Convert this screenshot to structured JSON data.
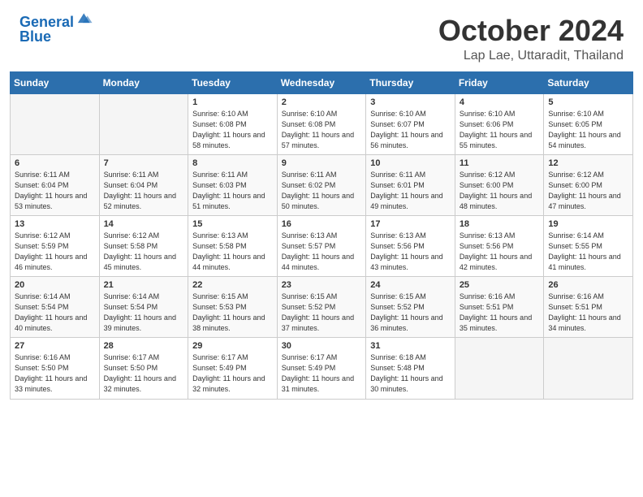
{
  "header": {
    "logo_line1": "General",
    "logo_line2": "Blue",
    "month": "October 2024",
    "location": "Lap Lae, Uttaradit, Thailand"
  },
  "weekdays": [
    "Sunday",
    "Monday",
    "Tuesday",
    "Wednesday",
    "Thursday",
    "Friday",
    "Saturday"
  ],
  "weeks": [
    [
      {
        "day": "",
        "info": ""
      },
      {
        "day": "",
        "info": ""
      },
      {
        "day": "1",
        "info": "Sunrise: 6:10 AM\nSunset: 6:08 PM\nDaylight: 11 hours and 58 minutes."
      },
      {
        "day": "2",
        "info": "Sunrise: 6:10 AM\nSunset: 6:08 PM\nDaylight: 11 hours and 57 minutes."
      },
      {
        "day": "3",
        "info": "Sunrise: 6:10 AM\nSunset: 6:07 PM\nDaylight: 11 hours and 56 minutes."
      },
      {
        "day": "4",
        "info": "Sunrise: 6:10 AM\nSunset: 6:06 PM\nDaylight: 11 hours and 55 minutes."
      },
      {
        "day": "5",
        "info": "Sunrise: 6:10 AM\nSunset: 6:05 PM\nDaylight: 11 hours and 54 minutes."
      }
    ],
    [
      {
        "day": "6",
        "info": "Sunrise: 6:11 AM\nSunset: 6:04 PM\nDaylight: 11 hours and 53 minutes."
      },
      {
        "day": "7",
        "info": "Sunrise: 6:11 AM\nSunset: 6:04 PM\nDaylight: 11 hours and 52 minutes."
      },
      {
        "day": "8",
        "info": "Sunrise: 6:11 AM\nSunset: 6:03 PM\nDaylight: 11 hours and 51 minutes."
      },
      {
        "day": "9",
        "info": "Sunrise: 6:11 AM\nSunset: 6:02 PM\nDaylight: 11 hours and 50 minutes."
      },
      {
        "day": "10",
        "info": "Sunrise: 6:11 AM\nSunset: 6:01 PM\nDaylight: 11 hours and 49 minutes."
      },
      {
        "day": "11",
        "info": "Sunrise: 6:12 AM\nSunset: 6:00 PM\nDaylight: 11 hours and 48 minutes."
      },
      {
        "day": "12",
        "info": "Sunrise: 6:12 AM\nSunset: 6:00 PM\nDaylight: 11 hours and 47 minutes."
      }
    ],
    [
      {
        "day": "13",
        "info": "Sunrise: 6:12 AM\nSunset: 5:59 PM\nDaylight: 11 hours and 46 minutes."
      },
      {
        "day": "14",
        "info": "Sunrise: 6:12 AM\nSunset: 5:58 PM\nDaylight: 11 hours and 45 minutes."
      },
      {
        "day": "15",
        "info": "Sunrise: 6:13 AM\nSunset: 5:58 PM\nDaylight: 11 hours and 44 minutes."
      },
      {
        "day": "16",
        "info": "Sunrise: 6:13 AM\nSunset: 5:57 PM\nDaylight: 11 hours and 44 minutes."
      },
      {
        "day": "17",
        "info": "Sunrise: 6:13 AM\nSunset: 5:56 PM\nDaylight: 11 hours and 43 minutes."
      },
      {
        "day": "18",
        "info": "Sunrise: 6:13 AM\nSunset: 5:56 PM\nDaylight: 11 hours and 42 minutes."
      },
      {
        "day": "19",
        "info": "Sunrise: 6:14 AM\nSunset: 5:55 PM\nDaylight: 11 hours and 41 minutes."
      }
    ],
    [
      {
        "day": "20",
        "info": "Sunrise: 6:14 AM\nSunset: 5:54 PM\nDaylight: 11 hours and 40 minutes."
      },
      {
        "day": "21",
        "info": "Sunrise: 6:14 AM\nSunset: 5:54 PM\nDaylight: 11 hours and 39 minutes."
      },
      {
        "day": "22",
        "info": "Sunrise: 6:15 AM\nSunset: 5:53 PM\nDaylight: 11 hours and 38 minutes."
      },
      {
        "day": "23",
        "info": "Sunrise: 6:15 AM\nSunset: 5:52 PM\nDaylight: 11 hours and 37 minutes."
      },
      {
        "day": "24",
        "info": "Sunrise: 6:15 AM\nSunset: 5:52 PM\nDaylight: 11 hours and 36 minutes."
      },
      {
        "day": "25",
        "info": "Sunrise: 6:16 AM\nSunset: 5:51 PM\nDaylight: 11 hours and 35 minutes."
      },
      {
        "day": "26",
        "info": "Sunrise: 6:16 AM\nSunset: 5:51 PM\nDaylight: 11 hours and 34 minutes."
      }
    ],
    [
      {
        "day": "27",
        "info": "Sunrise: 6:16 AM\nSunset: 5:50 PM\nDaylight: 11 hours and 33 minutes."
      },
      {
        "day": "28",
        "info": "Sunrise: 6:17 AM\nSunset: 5:50 PM\nDaylight: 11 hours and 32 minutes."
      },
      {
        "day": "29",
        "info": "Sunrise: 6:17 AM\nSunset: 5:49 PM\nDaylight: 11 hours and 32 minutes."
      },
      {
        "day": "30",
        "info": "Sunrise: 6:17 AM\nSunset: 5:49 PM\nDaylight: 11 hours and 31 minutes."
      },
      {
        "day": "31",
        "info": "Sunrise: 6:18 AM\nSunset: 5:48 PM\nDaylight: 11 hours and 30 minutes."
      },
      {
        "day": "",
        "info": ""
      },
      {
        "day": "",
        "info": ""
      }
    ]
  ]
}
